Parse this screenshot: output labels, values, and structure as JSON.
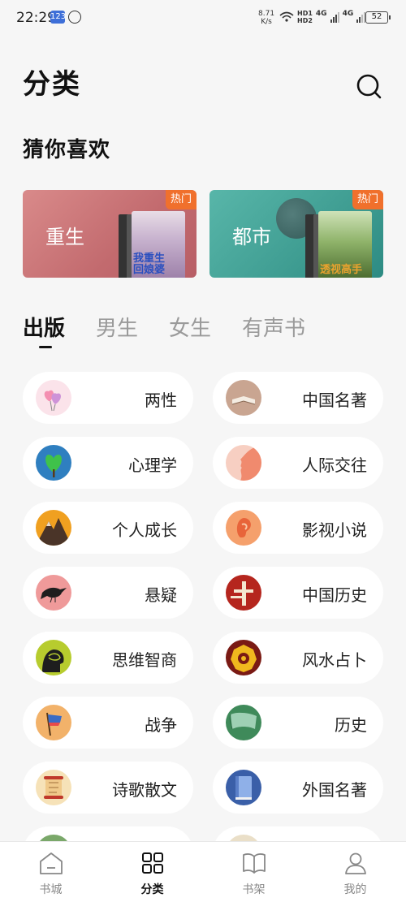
{
  "status_bar": {
    "time": "22:29",
    "badge": "123",
    "speed_value": "8.71",
    "speed_unit": "K/s",
    "hd1": "HD1",
    "hd2": "HD2",
    "net1": "4G",
    "net2": "4G",
    "battery": "52"
  },
  "header": {
    "title": "分类",
    "search_icon": "search-icon"
  },
  "recommend": {
    "title": "猜你喜欢",
    "cards": [
      {
        "label": "重生",
        "tag": "热门",
        "cover_text": "我重生",
        "cover_text2": "回娘婆"
      },
      {
        "label": "都市",
        "tag": "热门",
        "cover_text": "透视高手",
        "cover_text2": ""
      }
    ]
  },
  "tabs": [
    {
      "label": "出版",
      "active": true
    },
    {
      "label": "男生",
      "active": false
    },
    {
      "label": "女生",
      "active": false
    },
    {
      "label": "有声书",
      "active": false
    }
  ],
  "categories": [
    {
      "label": "两性",
      "icon": "hearts-icon"
    },
    {
      "label": "中国名著",
      "icon": "book-icon"
    },
    {
      "label": "心理学",
      "icon": "tree-icon"
    },
    {
      "label": "人际交往",
      "icon": "face-icon"
    },
    {
      "label": "个人成长",
      "icon": "mountain-icon"
    },
    {
      "label": "影视小说",
      "icon": "ear-icon"
    },
    {
      "label": "悬疑",
      "icon": "crow-icon"
    },
    {
      "label": "中国历史",
      "icon": "gate-icon"
    },
    {
      "label": "思维智商",
      "icon": "brain-icon"
    },
    {
      "label": "风水占卜",
      "icon": "bagua-icon"
    },
    {
      "label": "战争",
      "icon": "flag-icon"
    },
    {
      "label": "历史",
      "icon": "scroll-icon"
    },
    {
      "label": "诗歌散文",
      "icon": "scroll-paper-icon"
    },
    {
      "label": "外国名著",
      "icon": "blue-book-icon"
    }
  ],
  "bottom_nav": [
    {
      "label": "书城",
      "icon": "home-icon",
      "active": false
    },
    {
      "label": "分类",
      "icon": "grid-icon",
      "active": true
    },
    {
      "label": "书架",
      "icon": "open-book-icon",
      "active": false
    },
    {
      "label": "我的",
      "icon": "user-icon",
      "active": false
    }
  ]
}
